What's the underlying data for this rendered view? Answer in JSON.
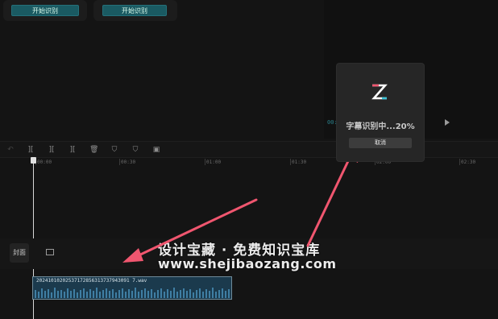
{
  "top_panel": {
    "start_recognize_label": "开始识别",
    "start_recognize2_label": "开始识别"
  },
  "player": {
    "timecode": "00:",
    "play_icon": "play-icon"
  },
  "toolbar": {
    "icons": [
      "undo-icon",
      "split-icon",
      "split-left-icon",
      "split-right-icon",
      "delete-icon",
      "mark-icon",
      "shield-icon",
      "crop-icon"
    ]
  },
  "ruler": {
    "labels": [
      "00:00",
      "00:30",
      "01:00",
      "01:30",
      "02:00",
      "02:30"
    ]
  },
  "dialog": {
    "progress_text": "字幕识别中...20%",
    "cancel_label": "取消"
  },
  "timeline": {
    "cover_label": "封面",
    "audio_clip_name": "20241010202537172856313737943091 7.wav"
  },
  "watermark": {
    "line1": "设计宝藏 · 免费知识宝库",
    "line2": "www.shejibaozang.com"
  },
  "colors": {
    "accent_teal": "#1a5a62",
    "arrow_pink": "#f0566f",
    "clip_blue": "#1b3a4d"
  }
}
